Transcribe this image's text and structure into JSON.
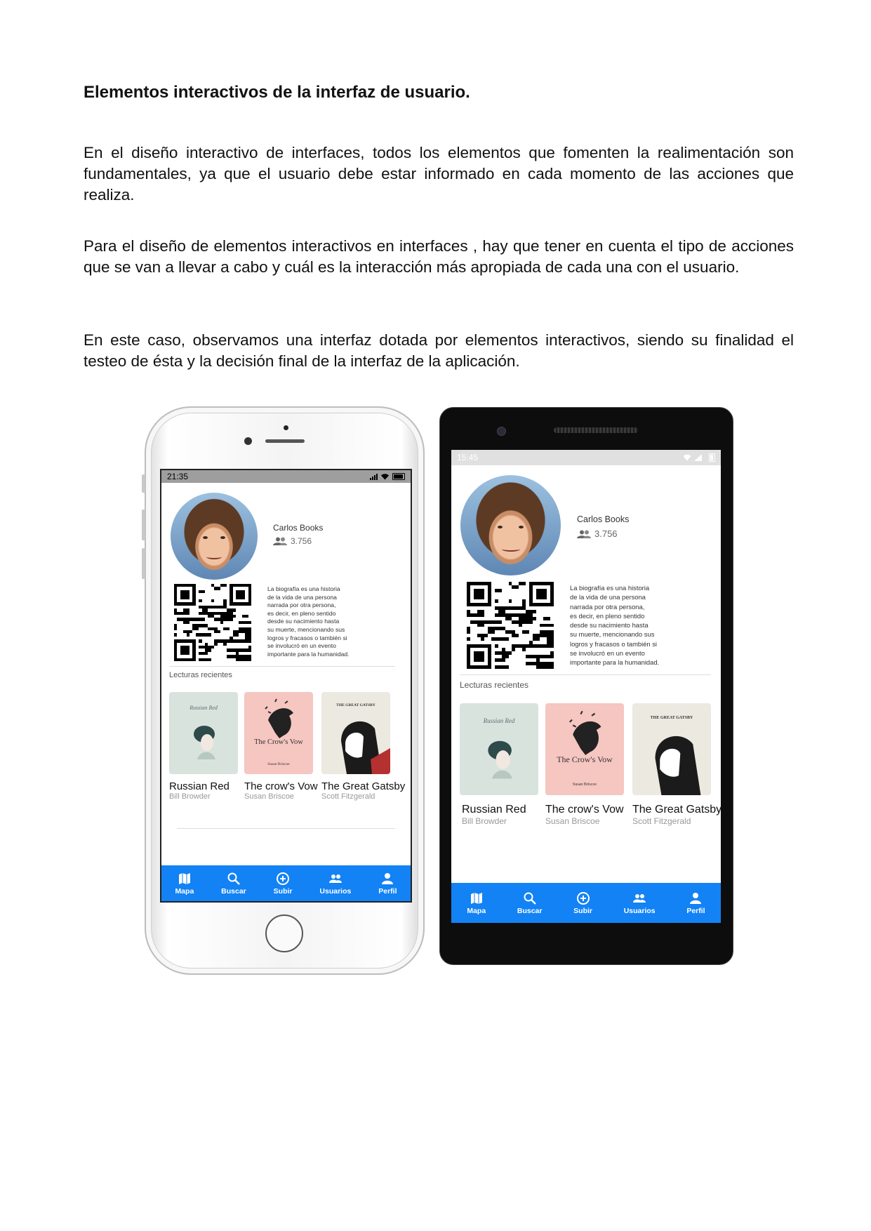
{
  "document": {
    "title": "Elementos interactivos de la interfaz de usuario.",
    "paragraphs": [
      "En el diseño interactivo de interfaces, todos los elementos que fomenten la realimentación son fundamentales, ya que el usuario debe estar informado en cada momento de las acciones que realiza.",
      "Para el diseño de elementos interactivos en interfaces , hay que tener en cuenta el tipo de acciones que se van a llevar a cabo y cuál es la interacción más apropiada de cada una con el usuario.",
      "En este caso, observamos una interfaz dotada por elementos interactivos, siendo su finalidad el testeo de ésta y la decisión final de la interfaz de la aplicación."
    ]
  },
  "iphone": {
    "time": "21:35"
  },
  "android": {
    "time": "15:45"
  },
  "profile": {
    "name": "Carlos Books",
    "followers": "3.756",
    "bio_lines": [
      "La biografía es una historia",
      "de la vida de una persona",
      "narrada por otra persona,",
      "es decir, en pleno sentido",
      "desde su nacimiento hasta",
      "su muerte, mencionando sus",
      "logros y fracasos o también si",
      "se involucró en un evento",
      "importante para la humanidad."
    ]
  },
  "recent_section_label": "Lecturas recientes",
  "books": [
    {
      "title": "Russian Red",
      "author": "Bill Browder",
      "cover_text": "Russian Red",
      "cover_sub": "",
      "icon": "woman-portrait-icon"
    },
    {
      "title": "The crow's Vow",
      "author": "Susan Briscoe",
      "cover_text": "The Crow's Vow",
      "cover_sub": "Susan Briscoe",
      "icon": "crow-icon"
    },
    {
      "title": "The Great Gatsby",
      "author": "Scott Fitzgerald",
      "cover_text": "THE GREAT GATSBY",
      "cover_sub": "",
      "icon": "man-silhouette-icon"
    }
  ],
  "nav": [
    {
      "label": "Mapa",
      "icon": "map-icon"
    },
    {
      "label": "Buscar",
      "icon": "search-icon"
    },
    {
      "label": "Subir",
      "icon": "add-circle-icon"
    },
    {
      "label": "Usuarios",
      "icon": "users-icon"
    },
    {
      "label": "Perfil",
      "icon": "person-icon"
    }
  ],
  "colors": {
    "nav_bg": "#1282f5",
    "cover_green": "#d9e3dd",
    "cover_pink": "#f6c6c1",
    "cover_cream": "#ece9e0"
  }
}
